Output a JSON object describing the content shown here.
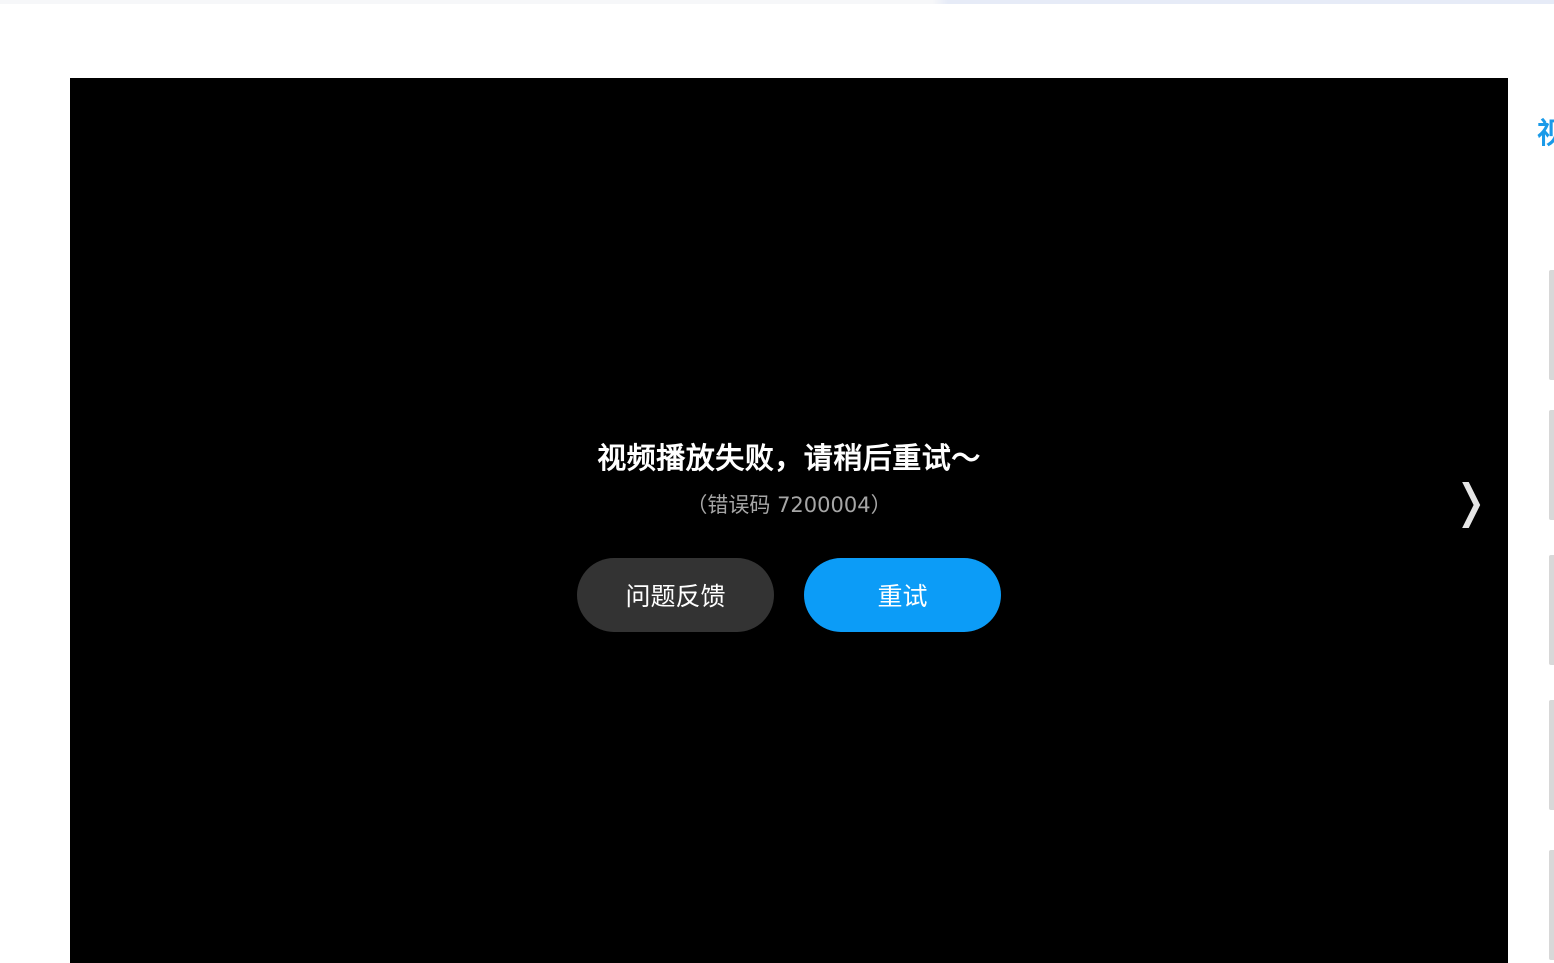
{
  "player": {
    "error_title": "视频播放失败，请稍后重试～",
    "error_code": "（错误码 7200004）",
    "feedback_button": "问题反馈",
    "retry_button": "重试",
    "next_icon": "chevron-right-icon"
  },
  "sidebar": {
    "title_partial": "视"
  },
  "colors": {
    "player_bg": "#000000",
    "retry_bg": "#0c9cf7",
    "feedback_bg": "#333333",
    "sidebar_title": "#1a9ae8"
  }
}
